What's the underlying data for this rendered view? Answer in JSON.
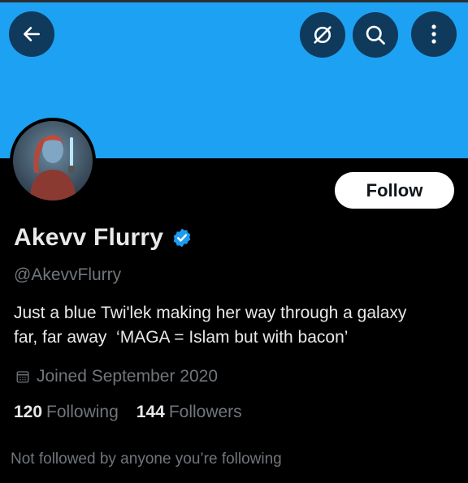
{
  "header": {
    "back_icon": "arrow-left-icon",
    "hide_icon": "eye-slash-icon",
    "search_icon": "search-icon",
    "more_icon": "more-vertical-icon",
    "banner_color": "#1da1f2",
    "button_color": "#0f3a5c"
  },
  "profile": {
    "avatar_icon": "profile-avatar",
    "follow_label": "Follow",
    "name": "Akevv Flurry",
    "verified_icon": "verified-badge-icon",
    "verified_color": "#1d9bf0",
    "handle": "@AkevvFlurry",
    "bio_line1": "Just a blue Twi'lek making her way through a galaxy",
    "bio_line2": "far, far away  ‘MAGA = Islam but with bacon’",
    "joined_icon": "calendar-icon",
    "joined": "Joined September 2020",
    "following_count": "120",
    "following_label": "Following",
    "followers_count": "144",
    "followers_label": "Followers",
    "not_followed": "Not followed by anyone you’re following"
  }
}
